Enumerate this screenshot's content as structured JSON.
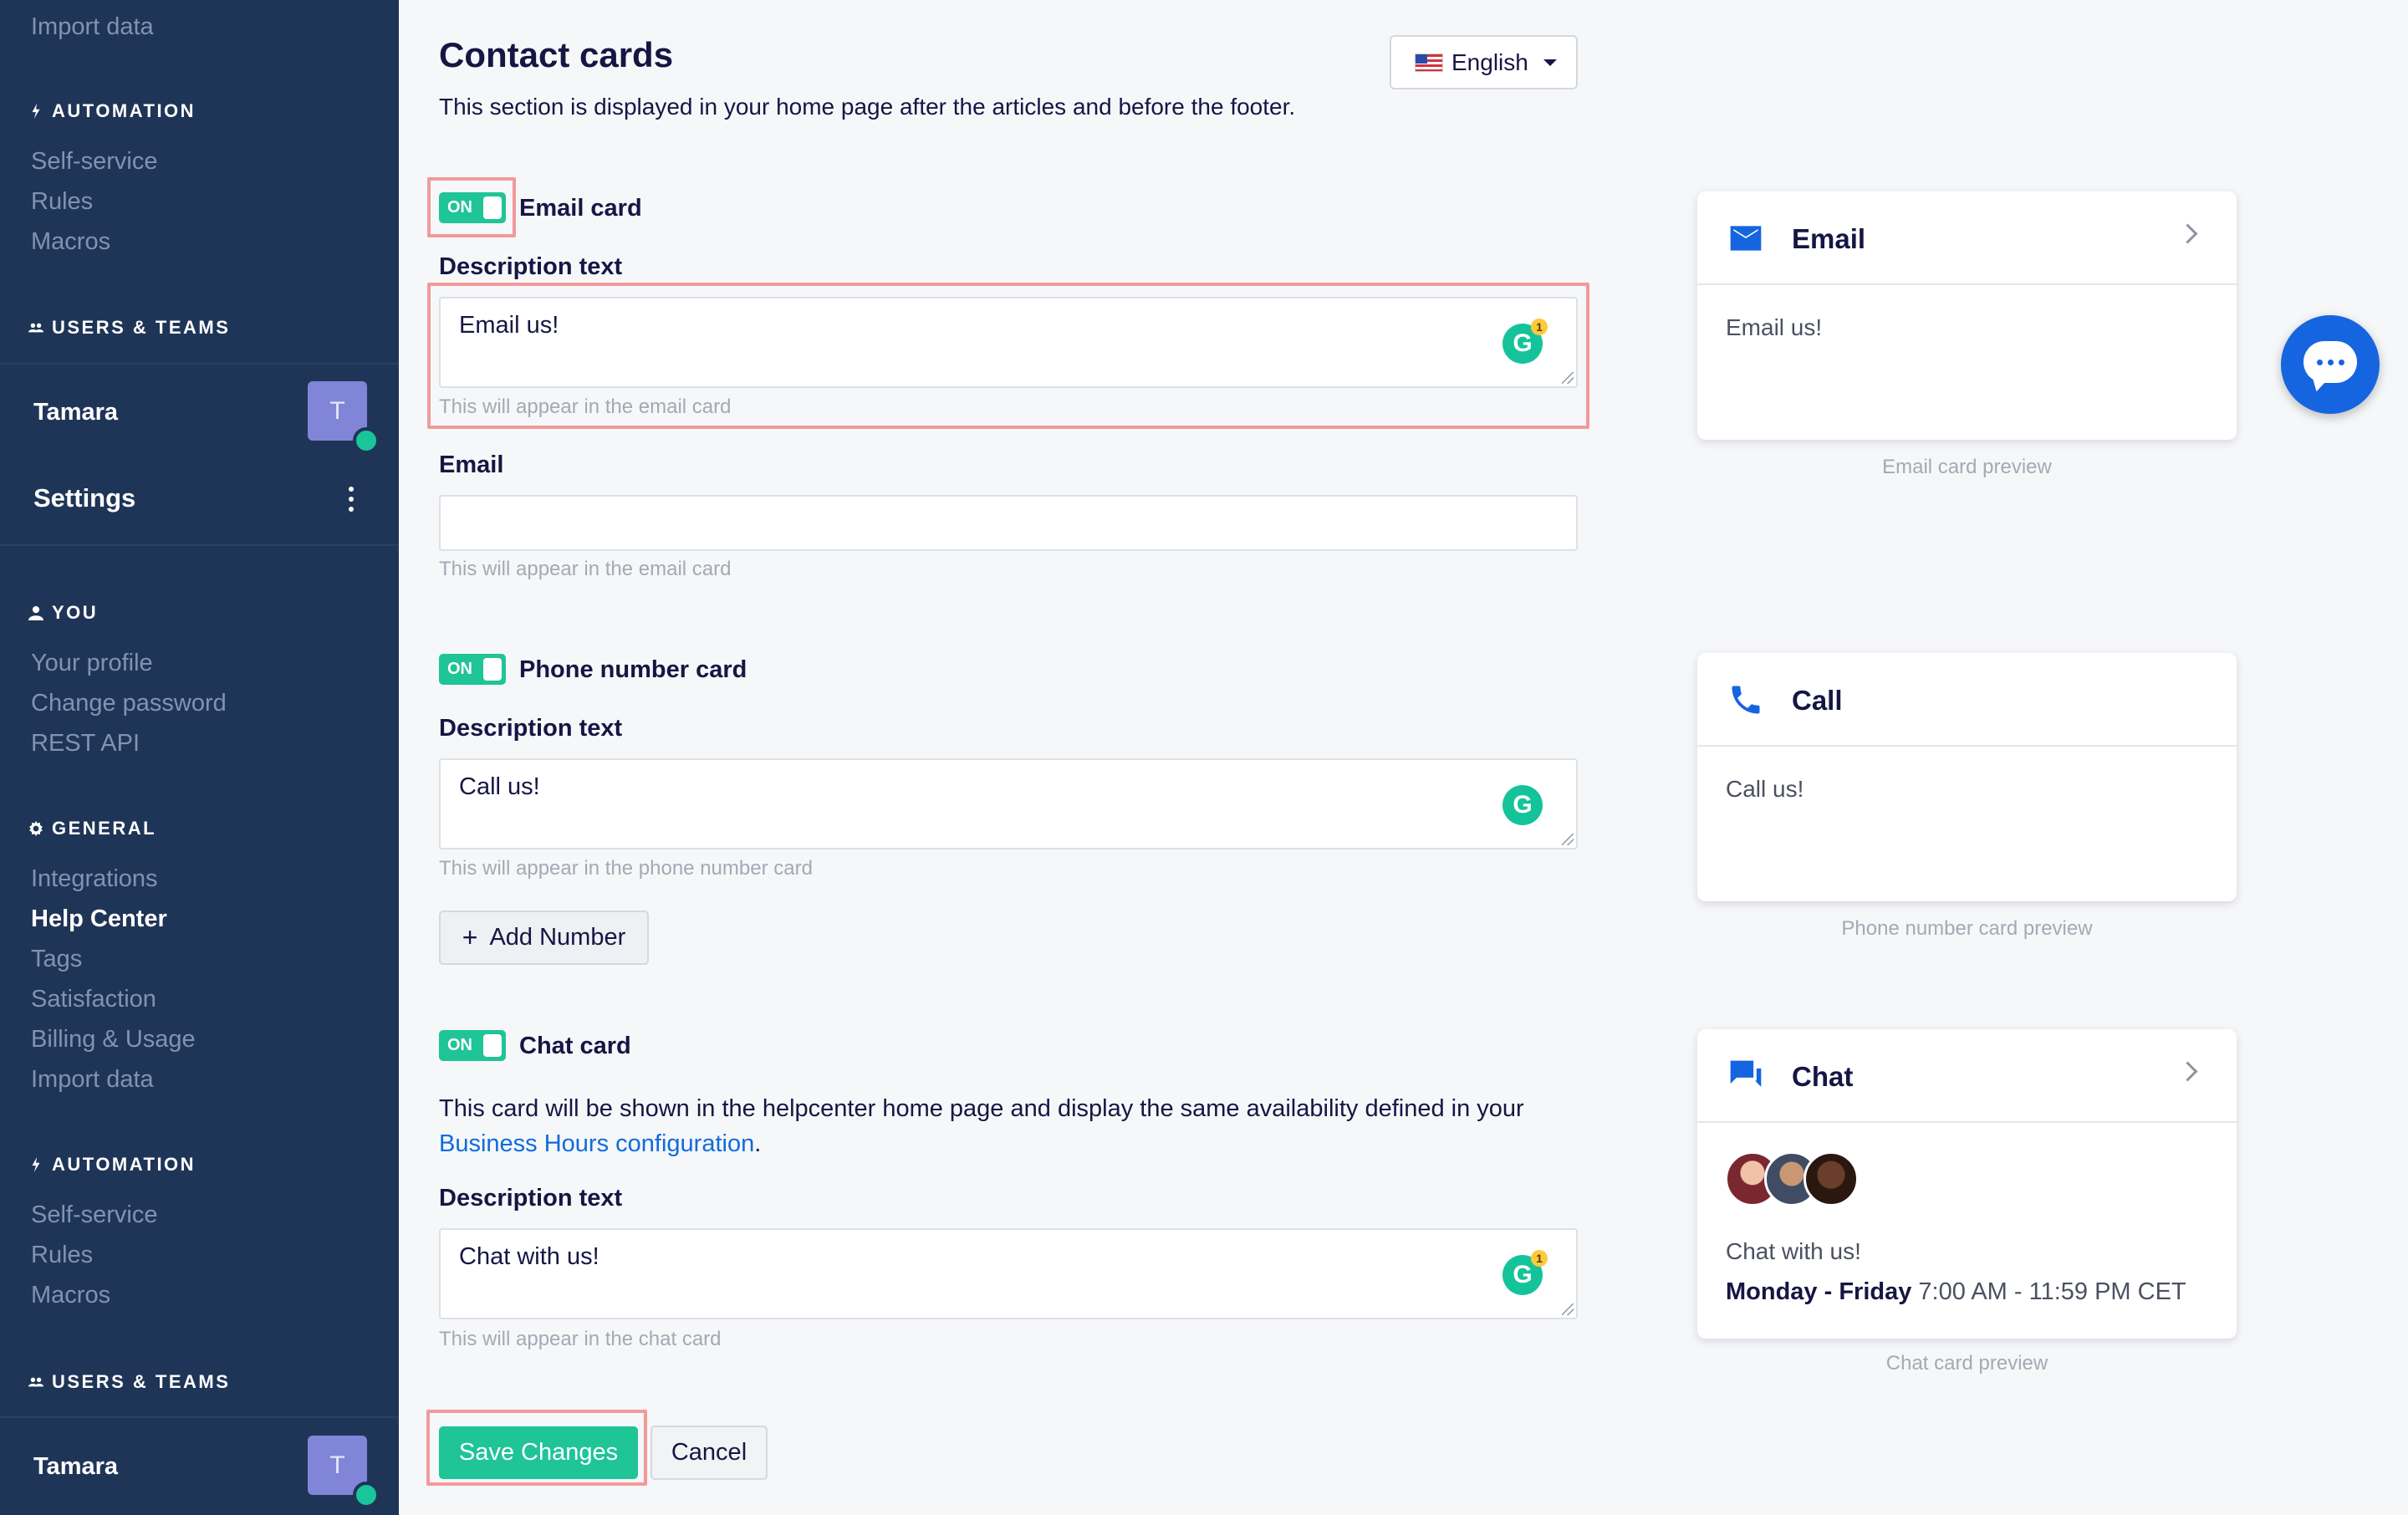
{
  "sidebar": {
    "top_item": "Import data",
    "sections": [
      {
        "heading": "AUTOMATION",
        "items": [
          "Self-service",
          "Rules",
          "Macros"
        ]
      },
      {
        "heading": "USERS & TEAMS"
      },
      {
        "heading": "YOU",
        "items": [
          "Your profile",
          "Change password",
          "REST API"
        ]
      },
      {
        "heading": "GENERAL",
        "items": [
          "Integrations",
          "Help Center",
          "Tags",
          "Satisfaction",
          "Billing & Usage",
          "Import data"
        ]
      },
      {
        "heading": "AUTOMATION",
        "items": [
          "Self-service",
          "Rules",
          "Macros"
        ]
      },
      {
        "heading": "USERS & TEAMS"
      }
    ],
    "user_name": "Tamara",
    "avatar_initial": "T",
    "settings_label": "Settings",
    "active_item": "Help Center"
  },
  "main": {
    "title": "Contact cards",
    "description": "This section is displayed in your home page after the articles and before the footer.",
    "language": "English",
    "toggle_on_label": "ON",
    "email_card": {
      "label": "Email card",
      "desc_label": "Description text",
      "desc_value": "Email us!",
      "desc_hint": "This will appear in the email card",
      "email_label": "Email",
      "email_value": "",
      "email_hint": "This will appear in the email card"
    },
    "phone_card": {
      "label": "Phone number card",
      "desc_label": "Description text",
      "desc_value": "Call us!",
      "desc_hint": "This will appear in the phone number card",
      "add_number": "Add Number"
    },
    "chat_card": {
      "label": "Chat card",
      "info_before": "This card will be shown in the helpcenter home page and display the same availability defined in your ",
      "info_link": "Business Hours configuration",
      "info_after": ".",
      "desc_label": "Description text",
      "desc_value": "Chat with us!",
      "desc_hint": "This will appear in the chat card"
    },
    "grammarly_badge": "1",
    "save_label": "Save Changes",
    "cancel_label": "Cancel"
  },
  "previews": {
    "email": {
      "title": "Email",
      "body": "Email us!",
      "caption": "Email card preview",
      "icon": "mail-icon"
    },
    "phone": {
      "title": "Call",
      "body": "Call us!",
      "caption": "Phone number card preview",
      "icon": "phone-icon"
    },
    "chat": {
      "title": "Chat",
      "body": "Chat with us!",
      "days": "Monday - Friday",
      "hours": " 7:00 AM - 11:59 PM CET",
      "caption": "Chat card preview",
      "icon": "chat-bubbles-icon"
    }
  },
  "colors": {
    "sidebar_bg": "#1f3557",
    "accent_green": "#1fc497",
    "brand_blue": "#1665e0",
    "highlight": "#f19a9a"
  }
}
